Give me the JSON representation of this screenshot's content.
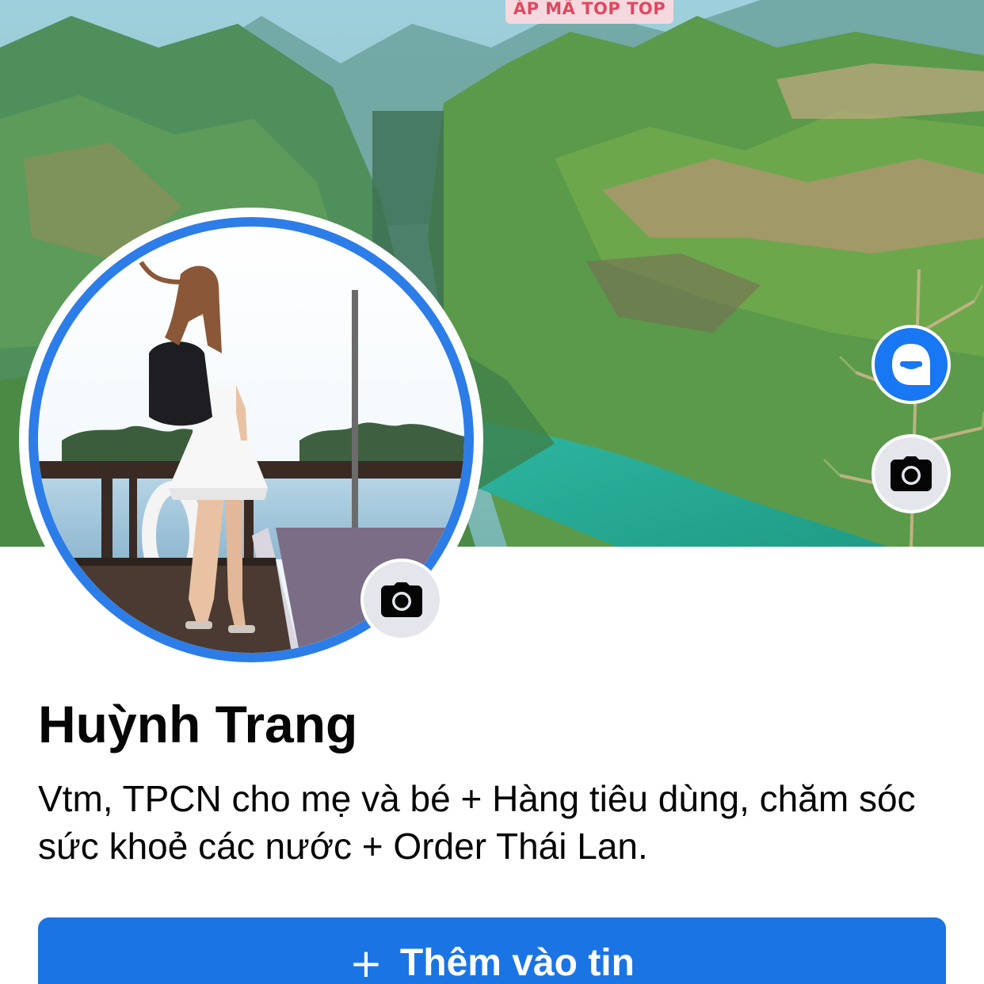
{
  "cover": {
    "tag_text": "ÁP MÃ TOP TOP"
  },
  "profile": {
    "name": "Huỳnh Trang",
    "bio": "Vtm, TPCN cho mẹ và bé + Hàng tiêu dùng, chăm sóc sức khoẻ các nước + Order Thái Lan."
  },
  "actions": {
    "add_story_icon": "plus-icon",
    "add_story_plus": "+",
    "add_story_label": "Thêm vào tin"
  },
  "icons": {
    "avatar_button": "avatar-icon",
    "cover_camera": "camera-icon",
    "profile_camera": "camera-icon"
  },
  "colors": {
    "accent": "#1b74e4",
    "ring": "#2d7de8",
    "tag_text": "#e0485f",
    "tag_bg": "#f6d9de"
  }
}
